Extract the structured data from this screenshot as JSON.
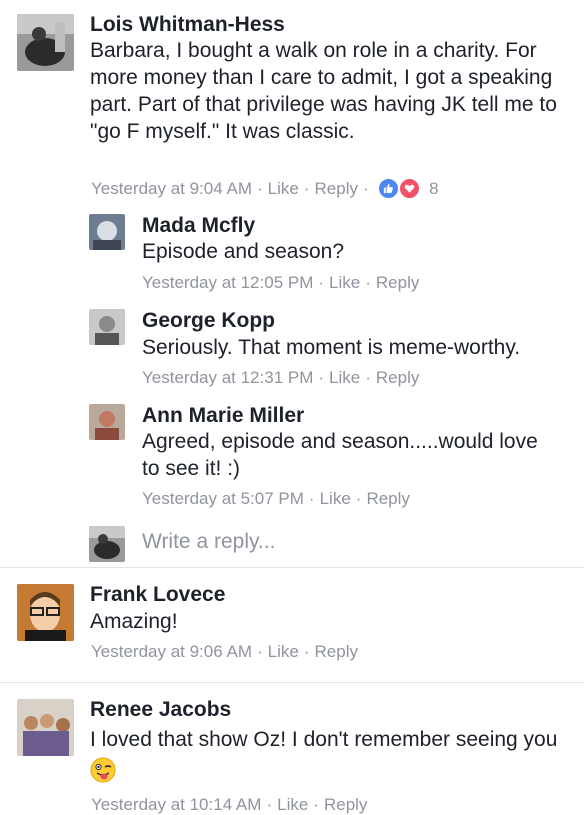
{
  "comments": [
    {
      "name": "Lois Whitman-Hess",
      "text": "Barbara, I bought a walk on role in a charity. For more money than I care to admit, I got a speaking part. Part of that privilege was having JK tell me to \"go F myself.\" It was classic.",
      "time": "Yesterday at 9:04 AM",
      "like": "Like",
      "reply": "Reply",
      "reactions": "8",
      "replies": [
        {
          "name": "Mada Mcfly",
          "text": "Episode and season?",
          "time": "Yesterday at 12:05 PM",
          "like": "Like",
          "reply": "Reply"
        },
        {
          "name": "George Kopp",
          "text": "Seriously. That moment is meme-worthy.",
          "time": "Yesterday at 12:31 PM",
          "like": "Like",
          "reply": "Reply"
        },
        {
          "name": "Ann Marie Miller",
          "text": "Agreed, episode and season.....would love to see it! :)",
          "time": "Yesterday at 5:07 PM",
          "like": "Like",
          "reply": "Reply"
        }
      ],
      "reply_placeholder": "Write a reply..."
    },
    {
      "name": "Frank Lovece",
      "text": "Amazing!",
      "time": "Yesterday at 9:06 AM",
      "like": "Like",
      "reply": "Reply"
    },
    {
      "name": "Renee Jacobs",
      "text": "I loved that show Oz! I don't remember seeing you",
      "time": "Yesterday at 10:14 AM",
      "like": "Like",
      "reply": "Reply"
    }
  ],
  "colors": {
    "meta": "#90949c",
    "like_reaction": "#4f87f2",
    "love_reaction": "#f25268"
  },
  "separator": "·"
}
